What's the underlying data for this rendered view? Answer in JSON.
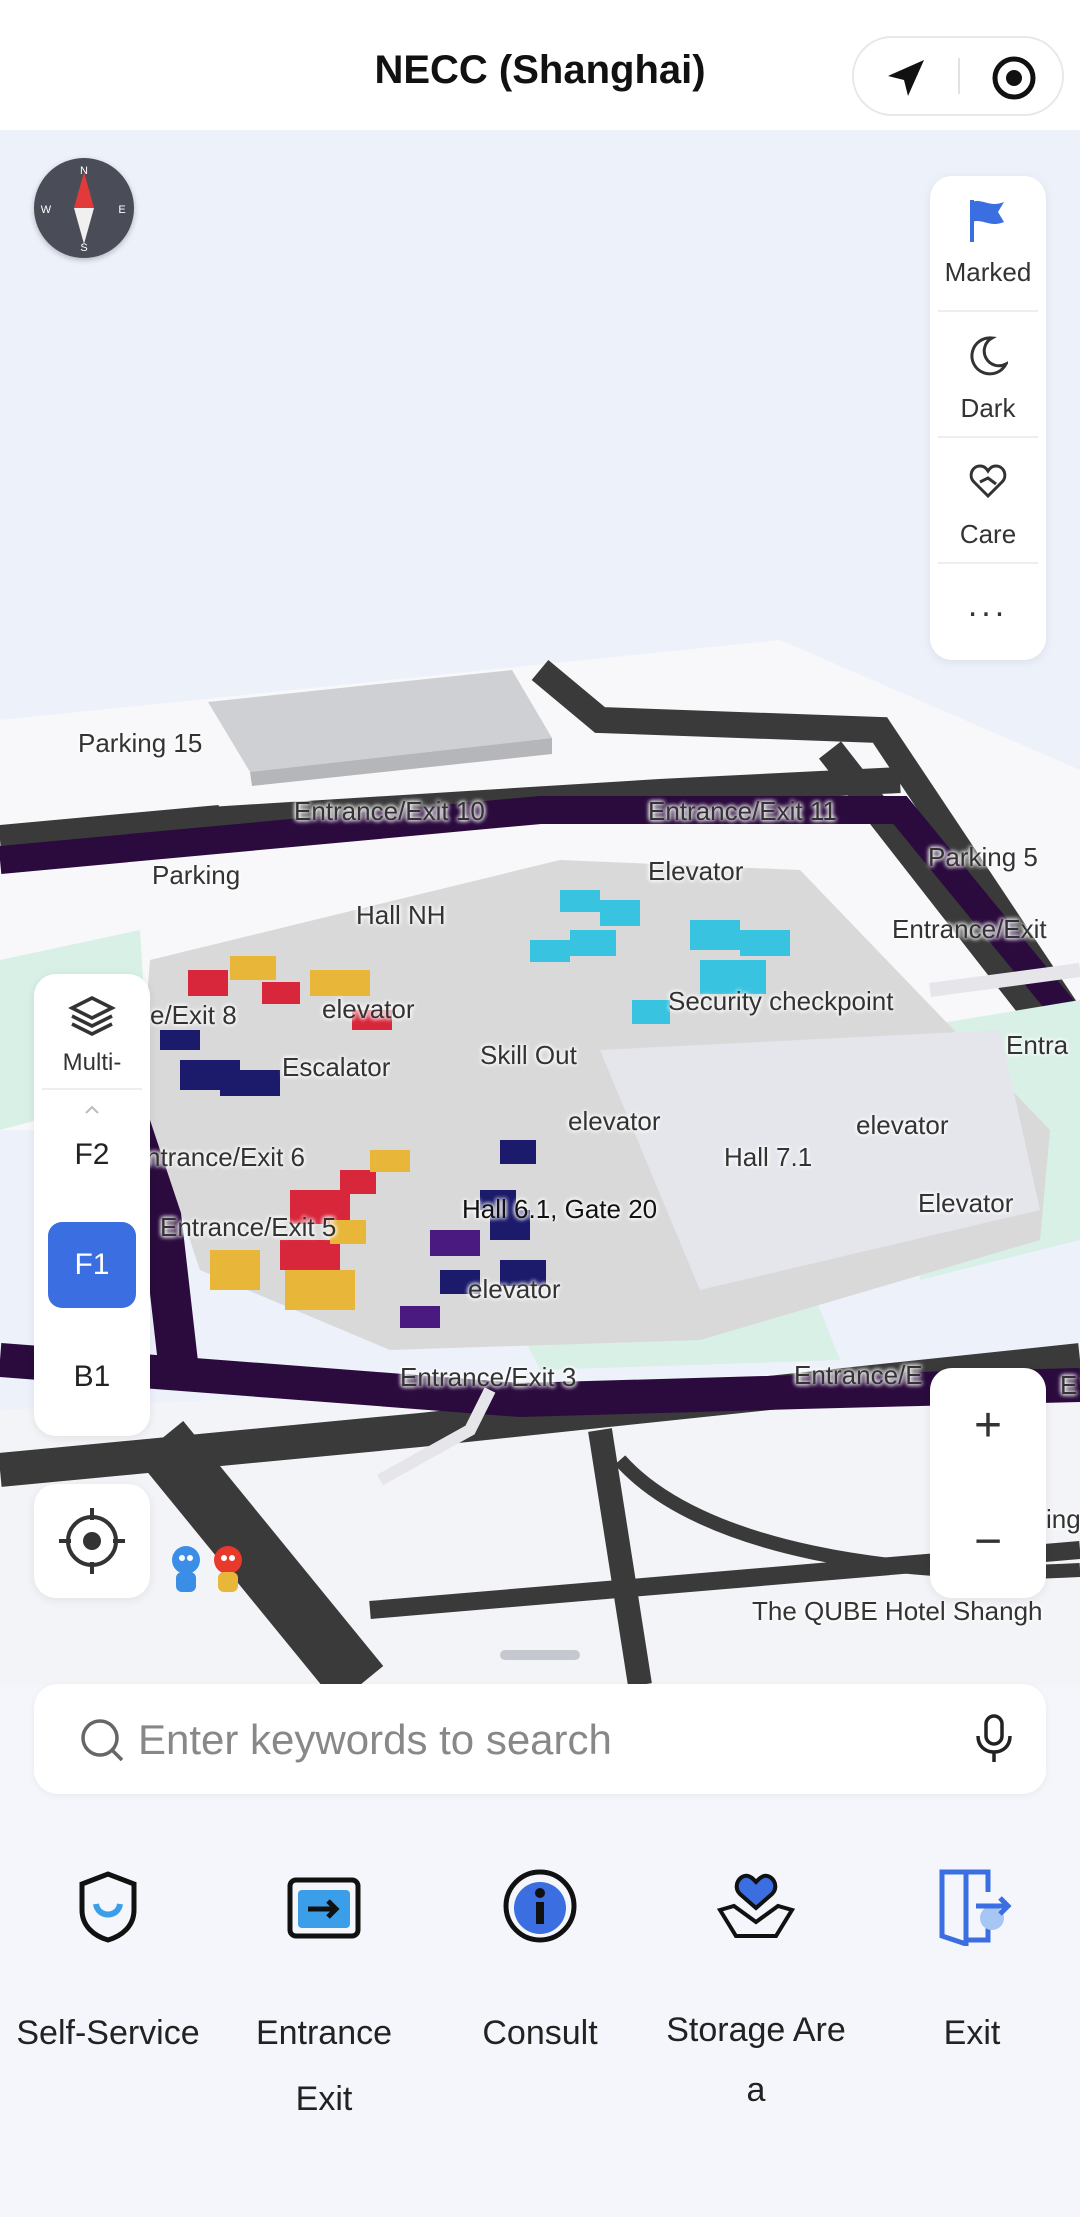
{
  "header": {
    "title": "NECC (Shanghai)"
  },
  "compass": {
    "n": "N",
    "s": "S",
    "e": "E",
    "w": "W"
  },
  "right_panel": {
    "items": [
      {
        "label": "Marked",
        "icon": "flag-icon"
      },
      {
        "label": "Dark",
        "icon": "moon-icon"
      },
      {
        "label": "Care",
        "icon": "heart-hands-icon"
      }
    ],
    "more": "..."
  },
  "floors": {
    "layers_label": "Multi-",
    "items": [
      "F2",
      "F1",
      "B1"
    ],
    "active": "F1"
  },
  "zoom": {
    "in": "+",
    "out": "−"
  },
  "map_labels": {
    "parking15": "Parking 15",
    "entrance10": "Entrance/Exit 10",
    "entrance11": "Entrance/Exit 11",
    "parking_left": "Parking",
    "parking5": "Parking 5",
    "elevator_top": "Elevator",
    "hall_nh": "Hall NH",
    "entrance_right": "Entrance/Exit",
    "exit8": "e/Exit 8",
    "elevator_a": "elevator",
    "security": "Security checkpoint",
    "entra": "Entra",
    "escalator": "Escalator",
    "skill_out": "Skill Out",
    "elevator_b": "elevator",
    "elevator_c": "elevator",
    "exit6": "ntrance/Exit 6",
    "hall71": "Hall 7.1",
    "exit5": "Entrance/Exit 5",
    "hall61": "Hall 6.1, Gate 20",
    "elevator_right": "Elevator",
    "elevator_d": "elevator",
    "exit3": "Entrance/Exit 3",
    "exit_e": "Entrance/E",
    "e_small": "E",
    "ing": "ing",
    "qube": "The QUBE Hotel Shangh"
  },
  "search": {
    "placeholder": "Enter keywords to search"
  },
  "actions": [
    {
      "label": "Self-Service",
      "icon": "self-service-icon"
    },
    {
      "label": "Entrance\nExit",
      "icon": "entrance-exit-icon"
    },
    {
      "label": "Consult",
      "icon": "info-icon"
    },
    {
      "label": "Storage Are\na",
      "icon": "storage-heart-icon"
    },
    {
      "label": "Exit",
      "icon": "exit-door-icon"
    }
  ],
  "colors": {
    "accent": "#3b6ee0",
    "road_dark": "#3a3a3a",
    "ring_road": "#2b0b3e",
    "venue": "#d9d9d9",
    "green": "#d8f0e6"
  }
}
